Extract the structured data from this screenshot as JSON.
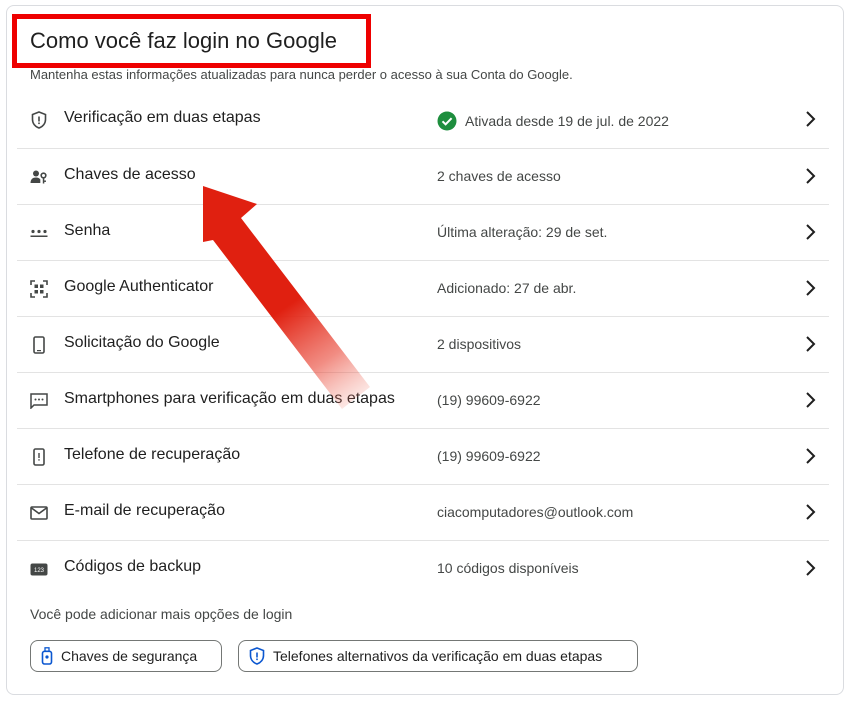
{
  "section": {
    "title": "Como você faz login no Google",
    "subtitle": "Mantenha estas informações atualizadas para nunca perder o acesso à sua Conta do Google."
  },
  "rows": [
    {
      "label": "Verificação em duas etapas",
      "value": "Ativada desde 19 de jul. de 2022",
      "icon": "shield-icon"
    },
    {
      "label": "Chaves de acesso",
      "value": "2 chaves de acesso",
      "icon": "person-key-icon"
    },
    {
      "label": "Senha",
      "value": "Última alteração: 29 de set.",
      "icon": "password-dots-icon"
    },
    {
      "label": "Google Authenticator",
      "value": "Adicionado: 27 de abr.",
      "icon": "qr-scan-icon"
    },
    {
      "label": "Solicitação do Google",
      "value": "2 dispositivos",
      "icon": "smartphone-icon"
    },
    {
      "label": "Smartphones para verificação em duas etapas",
      "value": "(19) 99609-6922",
      "icon": "sms-icon"
    },
    {
      "label": "Telefone de recuperação",
      "value": "(19) 99609-6922",
      "icon": "phone-alert-icon"
    },
    {
      "label": "E-mail de recuperação",
      "value": "ciacomputadores@outlook.com",
      "icon": "mail-icon"
    },
    {
      "label": "Códigos de backup",
      "value": "10 códigos disponíveis",
      "icon": "backup-codes-icon"
    }
  ],
  "more_options": {
    "text": "Você pode adicionar mais opções de login",
    "buttons": [
      {
        "label": "Chaves de segurança",
        "icon": "security-key-icon"
      },
      {
        "label": "Telefones alternativos da verificação em duas etapas",
        "icon": "shield-phone-icon"
      }
    ]
  },
  "colors": {
    "annotation_red": "#ee0000",
    "check_green": "#1e8e3e",
    "divider": "#e3e3e3",
    "text_primary": "#1f1f1f",
    "text_secondary": "#444746"
  }
}
